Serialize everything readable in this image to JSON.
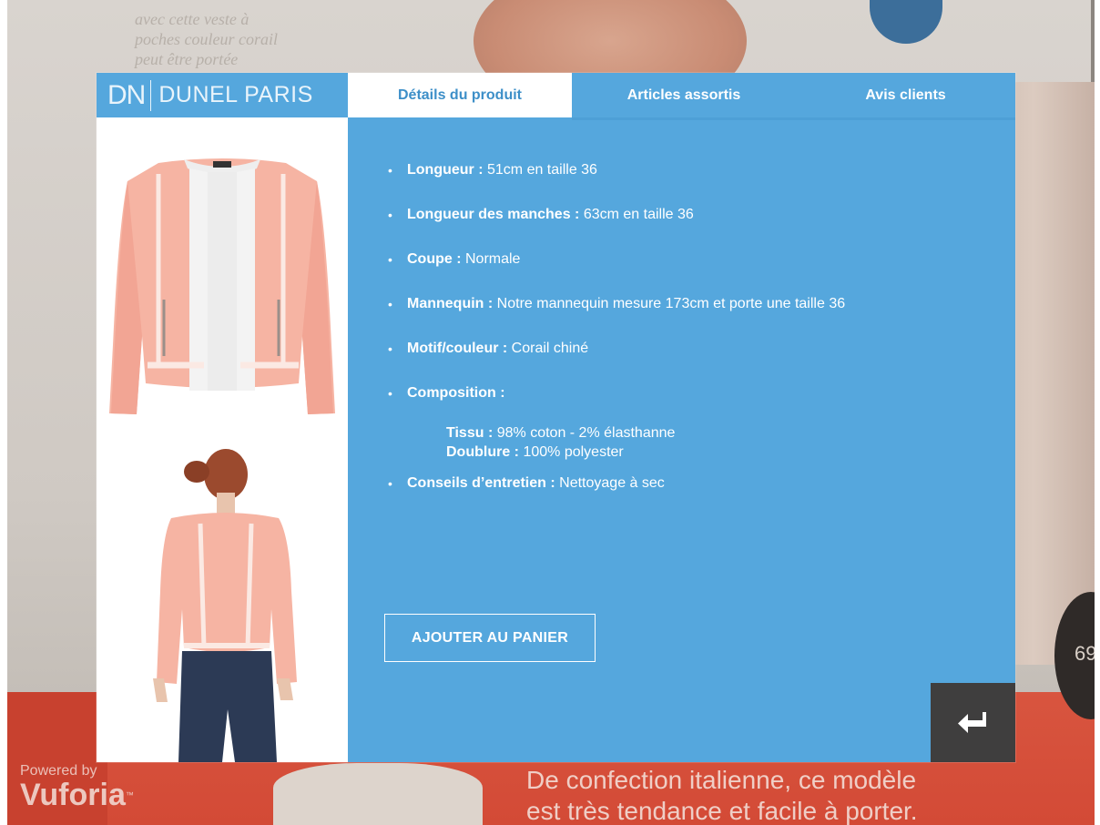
{
  "background": {
    "magazine_text_top": [
      "avec cette veste à",
      "poches couleur corail",
      "peut être portée"
    ],
    "magazine_text_bottom": [
      "De confection italienne, ce modèle",
      "est très tendance et facile à porter."
    ],
    "price_fragment": "69",
    "watermark": {
      "powered": "Powered by",
      "brand": "Vuforia"
    }
  },
  "brand": {
    "logo": "DN",
    "name": "DUNEL PARIS"
  },
  "tabs": [
    {
      "label": "Détails du produit",
      "active": true
    },
    {
      "label": "Articles assortis",
      "active": false
    },
    {
      "label": "Avis clients",
      "active": false
    }
  ],
  "specs": [
    {
      "label": "Longueur :",
      "value": " 51cm en taille 36"
    },
    {
      "label": "Longueur des manches :",
      "value": " 63cm en taille 36"
    },
    {
      "label": "Coupe :",
      "value": " Normale"
    },
    {
      "label": "Mannequin :",
      "value": " Notre mannequin mesure 173cm et porte une taille 36"
    },
    {
      "label": "Motif/couleur :",
      "value": " Corail chiné"
    },
    {
      "label": "Composition :",
      "value": ""
    }
  ],
  "composition": [
    {
      "label": "Tissu :",
      "value": " 98% coton - 2% élasthanne"
    },
    {
      "label": "Doublure :",
      "value": " 100% polyester"
    }
  ],
  "care": {
    "label": "Conseils d’entretien :",
    "value": " Nettoyage à sec"
  },
  "add_to_cart": "AJOUTER AU PANIER",
  "colors": {
    "panel_blue": "#55a7dd",
    "tab_active_text": "#3d8fc8",
    "back_button": "#3f3e3e",
    "jacket": "#f6b4a3"
  },
  "icons": {
    "back": "return-arrow-icon"
  }
}
